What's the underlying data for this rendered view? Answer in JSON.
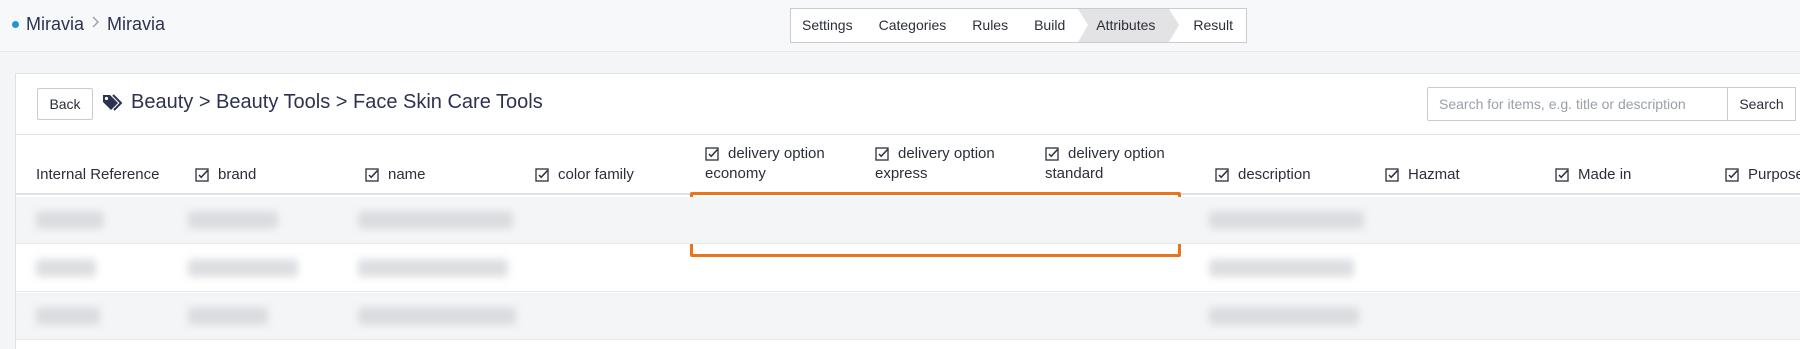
{
  "breadcrumb": {
    "root": "Miravia",
    "separator": ">",
    "current": "Miravia"
  },
  "steps": [
    "Settings",
    "Categories",
    "Rules",
    "Build",
    "Attributes",
    "Result"
  ],
  "active_step": "Attributes",
  "toolbar": {
    "back_label": "Back",
    "category_path": "Beauty > Beauty Tools > Face Skin Care Tools",
    "search_placeholder": "Search for items, e.g. title or description",
    "search_label": "Search"
  },
  "columns": [
    {
      "label": "Internal Reference",
      "checkable": false
    },
    {
      "label": "brand",
      "checkable": true
    },
    {
      "label": "name",
      "checkable": true
    },
    {
      "label": "color family",
      "checkable": true
    },
    {
      "label_lines": [
        "delivery option",
        "economy"
      ],
      "checkable": true
    },
    {
      "label_lines": [
        "delivery option",
        "express"
      ],
      "checkable": true
    },
    {
      "label_lines": [
        "delivery option",
        "standard"
      ],
      "checkable": true
    },
    {
      "label": "description",
      "checkable": true
    },
    {
      "label": "Hazmat",
      "checkable": true
    },
    {
      "label": "Made in",
      "checkable": true
    },
    {
      "label": "Purpose",
      "checkable": true
    }
  ],
  "colors": {
    "highlight": "#e8741c",
    "status_dot": "#2196d6"
  }
}
